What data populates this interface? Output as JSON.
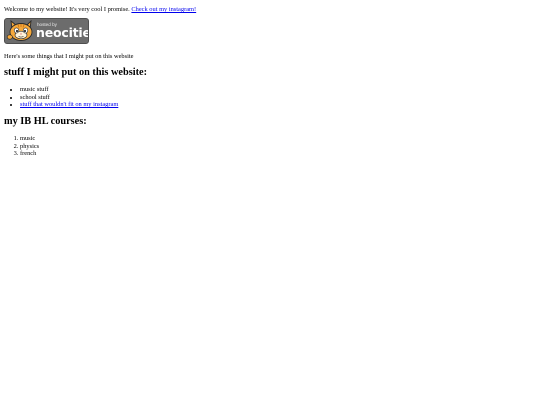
{
  "intro": {
    "text": "Welcome to my website! It's very cool I promise.",
    "link_label": "Check out my instagram!"
  },
  "badge": {
    "small_text": "hosted by",
    "brand_text": "neocities",
    "icon": "neocities-cat-logo",
    "background_color": "#6c6c6c"
  },
  "things_text": "Here's some things that I might put on this website",
  "stuff_section": {
    "heading": "stuff I might put on this website:",
    "items": [
      {
        "label": "music stuff",
        "is_link": false
      },
      {
        "label": "school stuff",
        "is_link": false
      },
      {
        "label": "stuff that wouldn't fit on my instagram",
        "is_link": true
      }
    ]
  },
  "courses_section": {
    "heading": "my IB HL courses:",
    "items": [
      "music",
      "physics",
      "french"
    ]
  },
  "colors": {
    "link": "#0000ee",
    "text": "#000000",
    "background": "#ffffff"
  }
}
